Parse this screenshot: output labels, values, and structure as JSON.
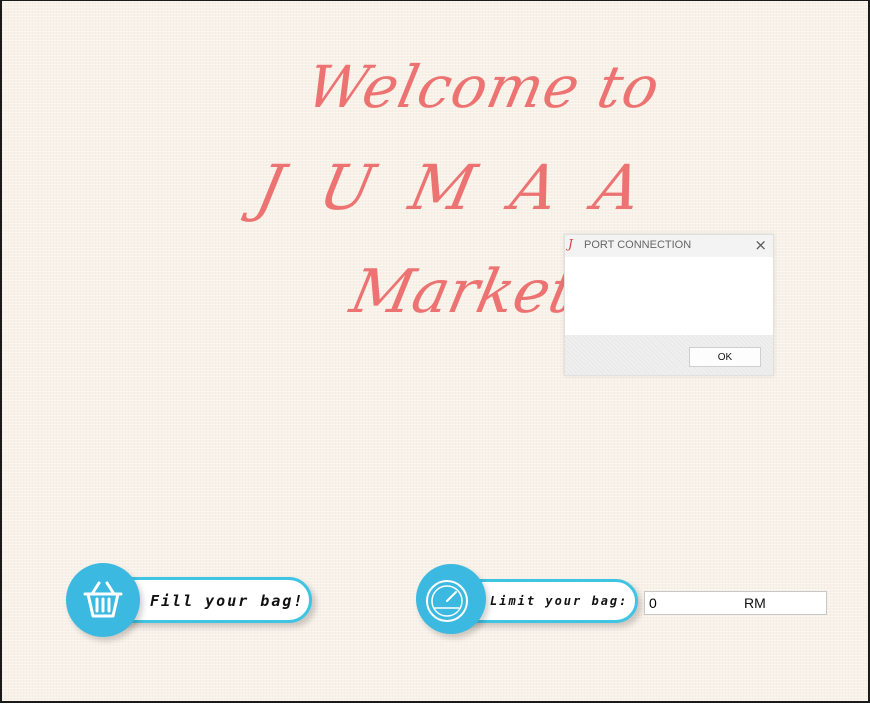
{
  "welcome": {
    "line1": "Welcome to",
    "line2": "JUMAA",
    "line3": "Market"
  },
  "dialog": {
    "logo": "J",
    "title": "PORT CONNECTION",
    "close": "×",
    "ok_label": "OK"
  },
  "fill_bag": {
    "label": "Fill your bag!",
    "icon": "basket-icon"
  },
  "limit_bag": {
    "label": "Limit your bag:",
    "icon": "gauge-icon",
    "value": "0",
    "unit": "RM"
  },
  "colors": {
    "title_pink": "#ec7372",
    "accent_blue": "#3bb9e0",
    "background": "#f8f1e8"
  }
}
